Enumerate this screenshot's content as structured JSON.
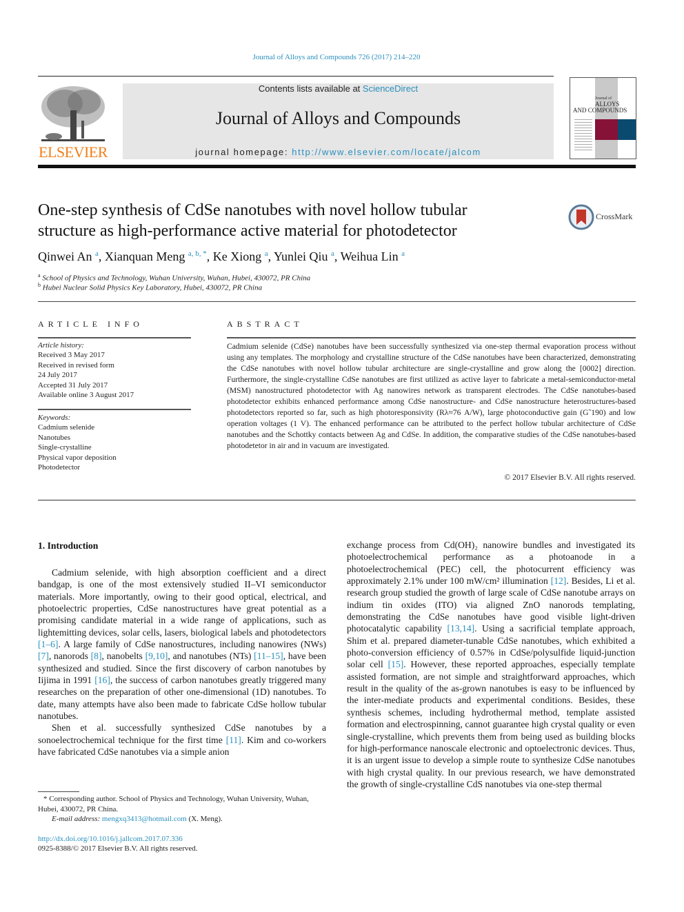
{
  "header": {
    "citation": "Journal of Alloys and Compounds 726 (2017) 214–220",
    "contents_prefix": "Contents lists available at ",
    "contents_link": "ScienceDirect",
    "journal_title": "Journal of Alloys and Compounds",
    "homepage_prefix": "journal homepage: ",
    "homepage_url": "http://www.elsevier.com/locate/jalcom",
    "publisher_logo_text": "ELSEVIER",
    "cover": {
      "line1": "Journal of",
      "line2": "ALLOYS",
      "line3": "AND COMPOUNDS",
      "colors": {
        "red": "#871237",
        "blue": "#0b4a6f"
      }
    },
    "crossmark_label": "CrossMark"
  },
  "article": {
    "title_line1": "One-step synthesis of CdSe nanotubes with novel hollow tubular",
    "title_line2": "structure as high-performance active material for photodetector",
    "authors": [
      {
        "name": "Qinwei An",
        "affil": "a",
        "sep": ", "
      },
      {
        "name": "Xianquan Meng",
        "affil": "a, b, *",
        "sep": ", "
      },
      {
        "name": "Ke Xiong",
        "affil": "a",
        "sep": ", "
      },
      {
        "name": "Yunlei Qiu",
        "affil": "a",
        "sep": ", "
      },
      {
        "name": "Weihua Lin",
        "affil": "a",
        "sep": ""
      }
    ],
    "affiliations": [
      {
        "mark": "a",
        "text": "School of Physics and Technology, Wuhan University, Wuhan, Hubei, 430072, PR China"
      },
      {
        "mark": "b",
        "text": "Hubei Nuclear Solid Physics Key Laboratory, Hubei, 430072, PR China"
      }
    ]
  },
  "article_info": {
    "heading": "ARTICLE INFO",
    "history_label": "Article history:",
    "history": [
      "Received 3 May 2017",
      "Received in revised form",
      "24 July 2017",
      "Accepted 31 July 2017",
      "Available online 3 August 2017"
    ],
    "keywords_label": "Keywords:",
    "keywords": [
      "Cadmium selenide",
      "Nanotubes",
      "Single-crystalline",
      "Physical vapor deposition",
      "Photodetector"
    ]
  },
  "abstract": {
    "heading": "ABSTRACT",
    "text": "Cadmium selenide (CdSe) nanotubes have been successfully synthesized via one-step thermal evaporation process without using any templates. The morphology and crystalline structure of the CdSe nanotubes have been characterized, demonstrating the CdSe nanotubes with novel hollow tubular architecture are single-crystalline and grow along the [0002] direction. Furthermore, the single-crystalline CdSe nanotubes are first utilized as active layer to fabricate a metal-semiconductor-metal (MSM) nanostructured photodetector with Ag nanowires network as transparent electrodes. The CdSe nanotubes-based photodetector exhibits enhanced performance among CdSe nanostructure- and CdSe nanostructure heterostructures-based photodetectors reported so far, such as high photoresponsivity (Rλ≈76 A/W), large photoconductive gain (G˜190) and low operation voltages (1 V). The enhanced performance can be attributed to the perfect hollow tubular architecture of CdSe nanotubes and the Schottky contacts between Ag and CdSe. In addition, the comparative studies of the CdSe nanotubes-based photodetetor in air and in vacuum are investigated.",
    "copyright": "© 2017 Elsevier B.V. All rights reserved."
  },
  "introduction": {
    "heading": "1.  Introduction",
    "left_p1": [
      {
        "t": "Cadmium selenide, with high absorption coefficient and a direct bandgap, is one of the most extensively studied II–VI semiconductor materials. More importantly, owing to their good optical, electrical, and photoelectric properties, CdSe nanostructures have great potential as a promising candidate material in a wide range of applications, such as lightemitting devices, solar cells, lasers, biological labels and photodetectors "
      },
      {
        "ref": "[1–6]"
      },
      {
        "t": ". A large family of CdSe nanostructures, including nanowires (NWs) "
      },
      {
        "ref": "[7]"
      },
      {
        "t": ", nanorods "
      },
      {
        "ref": "[8]"
      },
      {
        "t": ", nanobelts "
      },
      {
        "ref": "[9,10]"
      },
      {
        "t": ", and nanotubes (NTs) "
      },
      {
        "ref": "[11–15]"
      },
      {
        "t": ", have been synthesized and studied. Since the first discovery of carbon nanotubes by Iijima in 1991 "
      },
      {
        "ref": "[16]"
      },
      {
        "t": ", the success of carbon nanotubes greatly triggered many researches on the preparation of other one-dimensional (1D) nanotubes. To date, many attempts have also been made to fabricate CdSe hollow tubular nanotubes."
      }
    ],
    "left_p2": [
      {
        "t": "Shen et al. successfully synthesized CdSe nanotubes by a sonoelectrochemical technique for the first time "
      },
      {
        "ref": "[11]"
      },
      {
        "t": ". Kim and co-workers have fabricated CdSe nanotubes via a simple anion"
      }
    ],
    "right_p1": [
      {
        "t": "exchange process from Cd(OH)₂ nanowire bundles and investigated its photoelectrochemical performance as a photoanode in a photoelectrochemical (PEC) cell, the photocurrent efficiency was approximately 2.1% under 100 mW/cm² illumination "
      },
      {
        "ref": "[12]"
      },
      {
        "t": ". Besides, Li et al. research group studied the growth of large scale of CdSe nanotube arrays on indium tin oxides (ITO) via aligned ZnO nanorods templating, demonstrating the CdSe nanotubes have good visible light-driven photocatalytic capability "
      },
      {
        "ref": "[13,14]"
      },
      {
        "t": ". Using a sacrificial template approach, Shim et al. prepared diameter-tunable CdSe nanotubes, which exhibited a photo-conversion efficiency of 0.57% in CdSe/polysulfide liquid-junction solar cell "
      },
      {
        "ref": "[15]"
      },
      {
        "t": ". However, these reported approaches, especially template assisted formation, are not simple and straightforward approaches, which result in the quality of the as-grown nanotubes is easy to be influenced by the inter-mediate products and experimental conditions. Besides, these synthesis schemes, including hydrothermal method, template assisted formation and electrospinning, cannot guarantee high crystal quality or even single-crystalline, which prevents them from being used as building blocks for high-performance nanoscale electronic and optoelectronic devices. Thus, it is an urgent issue to develop a simple route to synthesize CdSe nanotubes with high crystal quality. In our previous research, we have demonstrated the growth of single-crystalline CdS nanotubes via one-step thermal"
      }
    ]
  },
  "footnotes": {
    "corresponding": "* Corresponding author. School of Physics and Technology, Wuhan University, Wuhan, Hubei, 430072, PR China.",
    "email_label": "E-mail address: ",
    "email": "mengxq3413@hotmail.com",
    "email_suffix": " (X. Meng).",
    "doi": "http://dx.doi.org/10.1016/j.jallcom.2017.07.336",
    "issn": "0925-8388/© 2017 Elsevier B.V. All rights reserved."
  },
  "colors": {
    "link": "#2a8fbd",
    "elsevier_orange": "#f07f1a",
    "banner_gray": "#e6e6e6"
  }
}
